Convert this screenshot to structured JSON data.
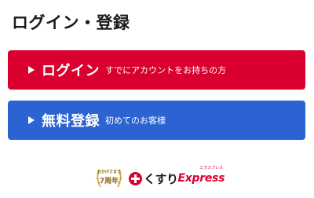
{
  "page": {
    "title": "ログイン・登録"
  },
  "buttons": {
    "login": {
      "label": "ログイン",
      "sub": "すでにアカウントをお持ちの方",
      "color": "#d9002f"
    },
    "register": {
      "label": "無料登録",
      "sub": "初めてのお客様",
      "color": "#2b63d2"
    }
  },
  "footer": {
    "anniversary_top": "おかげさまで",
    "anniversary_main": "7周年",
    "brand_main": "くすり",
    "brand_express": "Express",
    "brand_kana": "エクスプレス",
    "brand_color": "#d9002f"
  }
}
